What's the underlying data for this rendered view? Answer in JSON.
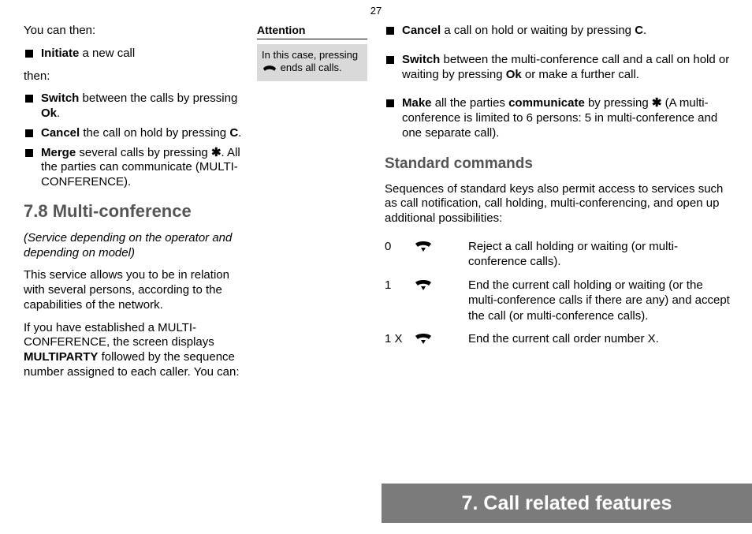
{
  "page_number": "27",
  "col1": {
    "intro1": "You can then:",
    "bullets1": [
      {
        "pre": "Initiate",
        "post": " a new call"
      }
    ],
    "intro2": "then:",
    "bullets2": [
      {
        "pre": "Switch",
        "mid": " between the calls by pressing ",
        "key": "Ok",
        "post": "."
      },
      {
        "pre": "Cancel",
        "mid": " the call on hold by pressing ",
        "key": "C",
        "post": "."
      },
      {
        "pre": "Merge",
        "mid": " several calls by pressing ",
        "key": "✱",
        "post": ".  All the parties can communicate (MULTI-CONFERENCE)."
      }
    ],
    "section_title": "7.8 Multi-conference",
    "note": "(Service depending on the operator and depending on model)",
    "para1": "This service allows you to be in relation with several persons, according to the capabilities of the network.",
    "para2_a": "If you have established a MULTI-CONFERENCE, the screen displays ",
    "para2_bold": "MULTIPARTY",
    "para2_b": " followed by the sequence number assigned to each caller. You can:"
  },
  "attention": {
    "heading": "Attention",
    "text_a": "In this case, pressing ",
    "text_b": " ends all calls.",
    "icon": "handset-icon"
  },
  "col3": {
    "bullets": [
      {
        "b1": "Cancel",
        "t1": " a call on hold or waiting by pressing ",
        "b2": "C",
        "t2": "."
      },
      {
        "b1": "Switch",
        "t1": " between the multi-conference call and a call on hold or waiting by pressing ",
        "b2": "Ok",
        "t2": " or make a further call."
      },
      {
        "b1": "Make",
        "t1": " all the parties ",
        "b2": "communicate",
        "t2": " by pressing ",
        "sym": "✱",
        "t3": " (A multi-conference is limited to 6 persons: 5 in multi-conference and one separate call)."
      }
    ],
    "sub_title": "Standard commands",
    "sub_para": "Sequences of standard keys also permit access to services such as call notification, call holding, multi-conferencing, and open up additional possibilities:",
    "commands": [
      {
        "key": "0",
        "icon": "handset-down-icon",
        "desc": "Reject a call holding or waiting (or multi-conference calls)."
      },
      {
        "key": "1",
        "icon": "handset-down-icon",
        "desc": "End the current call holding or waiting (or the multi-conference calls if there are any) and accept the call (or multi-conference calls)."
      },
      {
        "key": "1 X",
        "icon": "handset-down-icon",
        "desc": "End the current call order number X."
      }
    ]
  },
  "chapter": "7. Call related features"
}
